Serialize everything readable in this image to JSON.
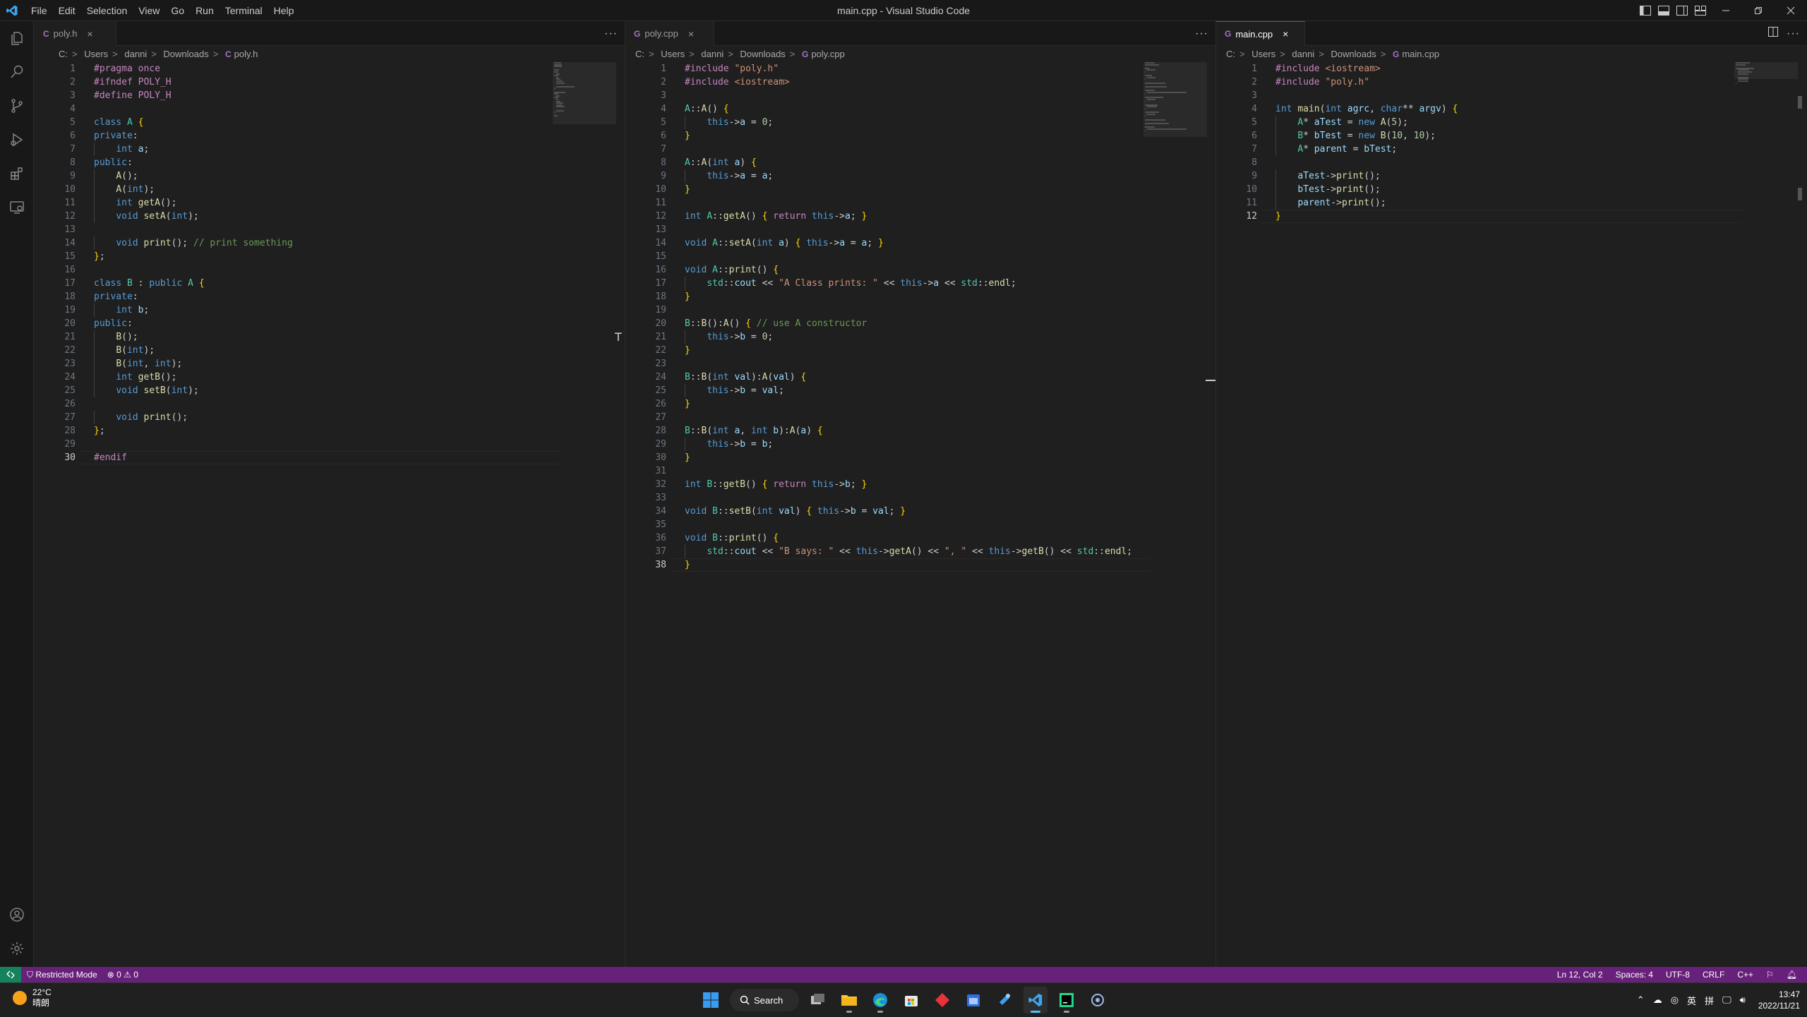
{
  "window": {
    "title": "main.cpp - Visual Studio Code",
    "menu": [
      "File",
      "Edit",
      "Selection",
      "View",
      "Go",
      "Run",
      "Terminal",
      "Help"
    ]
  },
  "colors": {
    "statusbar": "#68217a",
    "remote": "#16825d",
    "accent": "#0078d4"
  },
  "activitybar": [
    "explorer-icon",
    "search-icon",
    "source-control-icon",
    "run-debug-icon",
    "extensions-icon",
    "remote-explorer-icon",
    "accounts-icon",
    "manage-gear-icon"
  ],
  "editors": [
    {
      "tab": "poly.h",
      "tab_icon": "C",
      "active": false,
      "breadcrumb": [
        "C:",
        "Users",
        "danni",
        "Downloads",
        "poly.h"
      ],
      "current_line": 30,
      "lines": [
        "<span class=\"pp\">#pragma</span> <span class=\"pp\">once</span>",
        "<span class=\"pp\">#ifndef</span> <span class=\"pp\">POLY_H</span>",
        "<span class=\"pp\">#define</span> <span class=\"pp\">POLY_H</span>",
        "",
        "<span class=\"kw\">class</span> <span class=\"ty\">A</span> <span class=\"br\">{</span>",
        "<span class=\"kw\">private</span>:",
        "    <span class=\"kw\">int</span> <span class=\"vr\">a</span>;",
        "<span class=\"kw\">public</span>:",
        "    <span class=\"fn\">A</span>();",
        "    <span class=\"fn\">A</span>(<span class=\"kw\">int</span>);",
        "    <span class=\"kw\">int</span> <span class=\"fn\">getA</span>();",
        "    <span class=\"kw\">void</span> <span class=\"fn\">setA</span>(<span class=\"kw\">int</span>);",
        "",
        "    <span class=\"kw\">void</span> <span class=\"fn\">print</span>(); <span class=\"cm\">// print something</span>",
        "<span class=\"br\">}</span>;",
        "",
        "<span class=\"kw\">class</span> <span class=\"ty\">B</span> : <span class=\"kw\">public</span> <span class=\"ty\">A</span> <span class=\"br\">{</span>",
        "<span class=\"kw\">private</span>:",
        "    <span class=\"kw\">int</span> <span class=\"vr\">b</span>;",
        "<span class=\"kw\">public</span>:",
        "    <span class=\"fn\">B</span>();",
        "    <span class=\"fn\">B</span>(<span class=\"kw\">int</span>);",
        "    <span class=\"fn\">B</span>(<span class=\"kw\">int</span>, <span class=\"kw\">int</span>);",
        "    <span class=\"kw\">int</span> <span class=\"fn\">getB</span>();",
        "    <span class=\"kw\">void</span> <span class=\"fn\">setB</span>(<span class=\"kw\">int</span>);",
        "",
        "    <span class=\"kw\">void</span> <span class=\"fn\">print</span>();",
        "<span class=\"br\">}</span>;",
        "",
        "<span class=\"pp\">#endif</span>"
      ]
    },
    {
      "tab": "poly.cpp",
      "tab_icon": "G",
      "active": false,
      "breadcrumb": [
        "C:",
        "Users",
        "danni",
        "Downloads",
        "poly.cpp"
      ],
      "current_line": 38,
      "lines": [
        "<span class=\"pp\">#include</span> <span class=\"st\">\"poly.h\"</span>",
        "<span class=\"pp\">#include</span> <span class=\"st\">&lt;iostream&gt;</span>",
        "",
        "<span class=\"ty\">A</span>::<span class=\"fn\">A</span>() <span class=\"br\">{</span>",
        "    <span class=\"kw\">this</span>-&gt;<span class=\"vr\">a</span> = <span class=\"nm\">0</span>;",
        "<span class=\"br\">}</span>",
        "",
        "<span class=\"ty\">A</span>::<span class=\"fn\">A</span>(<span class=\"kw\">int</span> <span class=\"vr\">a</span>) <span class=\"br\">{</span>",
        "    <span class=\"kw\">this</span>-&gt;<span class=\"vr\">a</span> = <span class=\"vr\">a</span>;",
        "<span class=\"br\">}</span>",
        "",
        "<span class=\"kw\">int</span> <span class=\"ty\">A</span>::<span class=\"fn\">getA</span>() <span class=\"br\">{</span> <span class=\"pp\">return</span> <span class=\"kw\">this</span>-&gt;<span class=\"vr\">a</span>; <span class=\"br\">}</span>",
        "",
        "<span class=\"kw\">void</span> <span class=\"ty\">A</span>::<span class=\"fn\">setA</span>(<span class=\"kw\">int</span> <span class=\"vr\">a</span>) <span class=\"br\">{</span> <span class=\"kw\">this</span>-&gt;<span class=\"vr\">a</span> = <span class=\"vr\">a</span>; <span class=\"br\">}</span>",
        "",
        "<span class=\"kw\">void</span> <span class=\"ty\">A</span>::<span class=\"fn\">print</span>() <span class=\"br\">{</span>",
        "    <span class=\"nsp\">std</span>::<span class=\"vr\">cout</span> &lt;&lt; <span class=\"st\">\"A Class prints: \"</span> &lt;&lt; <span class=\"kw\">this</span>-&gt;<span class=\"vr\">a</span> &lt;&lt; <span class=\"nsp\">std</span>::<span class=\"fn\">endl</span>;",
        "<span class=\"br\">}</span>",
        "",
        "<span class=\"ty\">B</span>::<span class=\"fn\">B</span>():<span class=\"fn\">A</span>() <span class=\"br\">{</span> <span class=\"cm\">// use A constructor</span>",
        "    <span class=\"kw\">this</span>-&gt;<span class=\"vr\">b</span> = <span class=\"nm\">0</span>;",
        "<span class=\"br\">}</span>",
        "",
        "<span class=\"ty\">B</span>::<span class=\"fn\">B</span>(<span class=\"kw\">int</span> <span class=\"vr\">val</span>):<span class=\"fn\">A</span>(<span class=\"vr\">val</span>) <span class=\"br\">{</span>",
        "    <span class=\"kw\">this</span>-&gt;<span class=\"vr\">b</span> = <span class=\"vr\">val</span>;",
        "<span class=\"br\">}</span>",
        "",
        "<span class=\"ty\">B</span>::<span class=\"fn\">B</span>(<span class=\"kw\">int</span> <span class=\"vr\">a</span>, <span class=\"kw\">int</span> <span class=\"vr\">b</span>):<span class=\"fn\">A</span>(<span class=\"vr\">a</span>) <span class=\"br\">{</span>",
        "    <span class=\"kw\">this</span>-&gt;<span class=\"vr\">b</span> = <span class=\"vr\">b</span>;",
        "<span class=\"br\">}</span>",
        "",
        "<span class=\"kw\">int</span> <span class=\"ty\">B</span>::<span class=\"fn\">getB</span>() <span class=\"br\">{</span> <span class=\"pp\">return</span> <span class=\"kw\">this</span>-&gt;<span class=\"vr\">b</span>; <span class=\"br\">}</span>",
        "",
        "<span class=\"kw\">void</span> <span class=\"ty\">B</span>::<span class=\"fn\">setB</span>(<span class=\"kw\">int</span> <span class=\"vr\">val</span>) <span class=\"br\">{</span> <span class=\"kw\">this</span>-&gt;<span class=\"vr\">b</span> = <span class=\"vr\">val</span>; <span class=\"br\">}</span>",
        "",
        "<span class=\"kw\">void</span> <span class=\"ty\">B</span>::<span class=\"fn\">print</span>() <span class=\"br\">{</span>",
        "    <span class=\"nsp\">std</span>::<span class=\"vr\">cout</span> &lt;&lt; <span class=\"st\">\"B says: \"</span> &lt;&lt; <span class=\"kw\">this</span>-&gt;<span class=\"fn\">getA</span>() &lt;&lt; <span class=\"st\">\", \"</span> &lt;&lt; <span class=\"kw\">this</span>-&gt;<span class=\"fn\">getB</span>() &lt;&lt; <span class=\"nsp\">std</span>::<span class=\"fn\">endl</span>;",
        "<span class=\"br\">}</span>"
      ]
    },
    {
      "tab": "main.cpp",
      "tab_icon": "G",
      "active": true,
      "breadcrumb": [
        "C:",
        "Users",
        "danni",
        "Downloads",
        "main.cpp"
      ],
      "current_line": 12,
      "lines": [
        "<span class=\"pp\">#include</span> <span class=\"st\">&lt;iostream&gt;</span>",
        "<span class=\"pp\">#include</span> <span class=\"st\">\"poly.h\"</span>",
        "",
        "<span class=\"kw\">int</span> <span class=\"fn\">main</span>(<span class=\"kw\">int</span> <span class=\"vr\">agrc</span>, <span class=\"kw\">char</span>** <span class=\"vr\">argv</span>) <span class=\"br\">{</span>",
        "    <span class=\"ty\">A</span>* <span class=\"vr\">aTest</span> = <span class=\"kw\">new</span> <span class=\"fn\">A</span>(<span class=\"nm\">5</span>);",
        "    <span class=\"ty\">B</span>* <span class=\"vr\">bTest</span> = <span class=\"kw\">new</span> <span class=\"fn\">B</span>(<span class=\"nm\">10</span>, <span class=\"nm\">10</span>);",
        "    <span class=\"ty\">A</span>* <span class=\"vr\">parent</span> = <span class=\"vr\">bTest</span>;",
        "",
        "    <span class=\"vr\">aTest</span>-&gt;<span class=\"fn\">print</span>();",
        "    <span class=\"vr\">bTest</span>-&gt;<span class=\"fn\">print</span>();",
        "    <span class=\"vr\">parent</span>-&gt;<span class=\"fn\">print</span>();",
        "<span class=\"br\">}</span>"
      ]
    }
  ],
  "statusbar": {
    "restricted": "Restricted Mode",
    "problems": "⊗ 0 ⚠ 0",
    "position": "Ln 12, Col 2",
    "spaces": "Spaces: 4",
    "encoding": "UTF-8",
    "eol": "CRLF",
    "language": "C++"
  },
  "taskbar": {
    "temperature": "22°C",
    "weather": "晴朗",
    "search": "Search",
    "ime": "英",
    "ime2": "拼",
    "time": "13:47",
    "date": "2022/11/21"
  }
}
